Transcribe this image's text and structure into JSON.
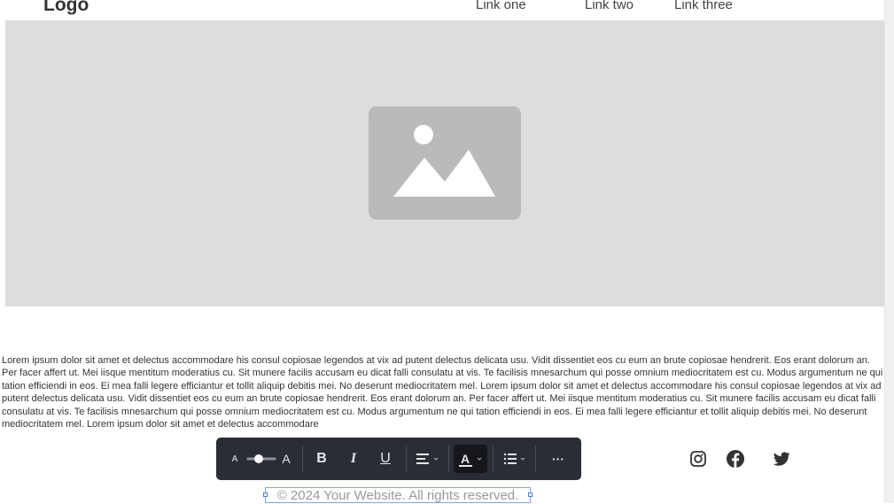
{
  "header": {
    "logo": "Logo",
    "nav": [
      "Link one",
      "Link two",
      "Link three"
    ]
  },
  "hero": {
    "image_icon": "image-placeholder-icon"
  },
  "content": {
    "paragraph": "Lorem ipsum dolor sit amet et delectus accommodare his consul copiosae legendos at vix ad putent delectus delicata usu. Vidit dissentiet eos cu eum an brute copiosae hendrerit. Eos erant dolorum an. Per facer affert ut. Mei iisque mentitum moderatius cu. Sit munere facilis accusam eu dicat falli consulatu at vis. Te facilisis mnesarchum qui posse omnium mediocritatem est cu. Modus argumentum ne qui tation efficiendi in eos. Ei mea falli legere efficiantur et tollit aliquip debitis mei. No deserunt mediocritatem mel. Lorem ipsum dolor sit amet et delectus accommodare his consul copiosae legendos at vix ad putent delectus delicata usu. Vidit dissentiet eos cu eum an brute copiosae hendrerit. Eos erant dolorum an. Per facer affert ut. Mei iisque mentitum moderatius cu. Sit munere facilis accusam eu dicat falli consulatu at vis. Te facilisis mnesarchum qui posse omnium mediocritatem est cu. Modus argumentum ne qui tation efficiendi in eos. Ei mea falli legere efficiantur et tollit aliquip debitis mei. No deserunt mediocritatem mel. Lorem ipsum dolor sit amet et delectus accommodare"
  },
  "toolbar": {
    "size_small": "A",
    "size_large": "A",
    "font_size_level": 0.4,
    "bold": "B",
    "italic": "I",
    "underline": "U",
    "text_color_label": "A",
    "more": "···",
    "icons": [
      "font-size-slider-icon",
      "align-left-icon",
      "text-color-icon",
      "list-icon",
      "more-icon"
    ]
  },
  "social": {
    "icons": [
      "instagram-icon",
      "facebook-icon",
      "twitter-icon"
    ]
  },
  "footer": {
    "copyright": "© 2024 Your Website. All rights reserved."
  },
  "colors": {
    "toolbar_bg": "#2b2d35",
    "hero_bg": "#dddddd",
    "placeholder": "#bababa",
    "selection": "#4a7fd8"
  }
}
